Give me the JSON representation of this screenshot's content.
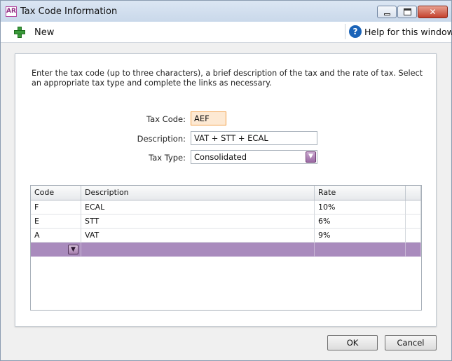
{
  "window": {
    "app_icon": "AR",
    "title": "Tax Code Information"
  },
  "toolbar": {
    "new_label": "New",
    "help_label": "Help for this window"
  },
  "form": {
    "intro": "Enter the tax code (up to three characters), a brief description of the tax and the rate of tax. Select an appropriate tax type and complete the links as necessary.",
    "tax_code_label": "Tax Code:",
    "tax_code_value": "AEF",
    "description_label": "Description:",
    "description_value": "VAT + STT + ECAL",
    "tax_type_label": "Tax Type:",
    "tax_type_value": "Consolidated"
  },
  "grid": {
    "columns": [
      "Code",
      "Description",
      "Rate"
    ],
    "rows": [
      {
        "code": "F",
        "description": "ECAL",
        "rate": "10%"
      },
      {
        "code": "E",
        "description": "STT",
        "rate": "6%"
      },
      {
        "code": "A",
        "description": "VAT",
        "rate": "9%"
      }
    ]
  },
  "buttons": {
    "ok": "OK",
    "cancel": "Cancel"
  },
  "colors": {
    "accent_purple": "#a98bbd",
    "code_field_bg": "#fde9d3",
    "close_button": "#c4412d"
  }
}
